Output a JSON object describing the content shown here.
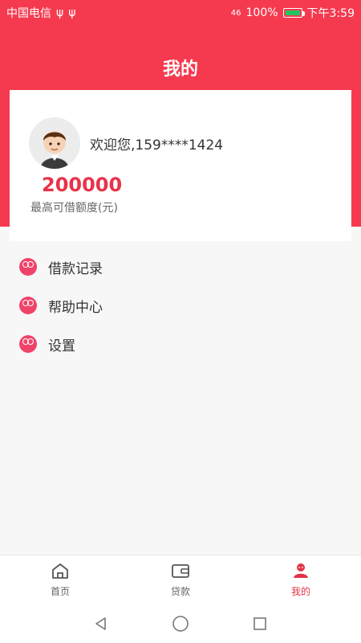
{
  "status": {
    "carrier": "中国电信",
    "signal": "46",
    "battery": "100%",
    "time": "下午3:59"
  },
  "header": {
    "title": "我的"
  },
  "profile": {
    "welcome_prefix": "欢迎您,",
    "phone": "159****1424",
    "credit_amount": "200000",
    "credit_label": "最高可借额度(元)"
  },
  "menu": {
    "items": [
      {
        "label": "借款记录",
        "icon": "people-icon"
      },
      {
        "label": "帮助中心",
        "icon": "people-icon"
      },
      {
        "label": "设置",
        "icon": "people-icon"
      }
    ]
  },
  "tabs": [
    {
      "label": "首页",
      "icon": "home-icon"
    },
    {
      "label": "贷款",
      "icon": "wallet-icon"
    },
    {
      "label": "我的",
      "icon": "user-icon",
      "active": true
    }
  ],
  "colors": {
    "brand": "#f53a4f",
    "accent": "#e8334a",
    "menu_icon": "#f0436a"
  }
}
